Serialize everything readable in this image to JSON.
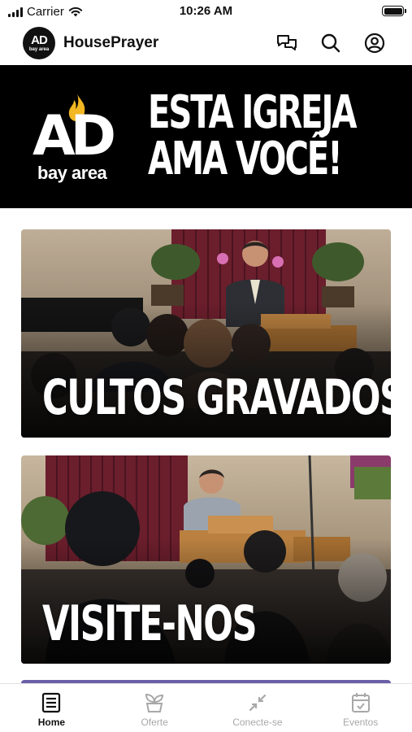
{
  "status_bar": {
    "carrier": "Carrier",
    "time": "10:26 AM"
  },
  "header": {
    "app_name": "HousePrayer",
    "logo_line1": "AD",
    "logo_line2": "bay area",
    "icons": [
      "chat-icon",
      "search-icon",
      "account-icon"
    ]
  },
  "hero": {
    "logo_main": "AD",
    "logo_sub": "bay area",
    "line1": "ESTA IGREJA",
    "line2": "AMA VOCÊ!"
  },
  "cards": [
    {
      "label": "CULTOS GRAVADOS"
    },
    {
      "label": "VISITE-NOS"
    }
  ],
  "tabs": [
    {
      "label": "Home",
      "icon": "home-icon",
      "active": true
    },
    {
      "label": "Oferte",
      "icon": "plant-icon",
      "active": false
    },
    {
      "label": "Conecte-se",
      "icon": "connect-icon",
      "active": false
    },
    {
      "label": "Eventos",
      "icon": "calendar-icon",
      "active": false
    }
  ],
  "colors": {
    "accent": "#6b5fa8",
    "hero_background": "#000000",
    "flame": "#f2b722"
  }
}
